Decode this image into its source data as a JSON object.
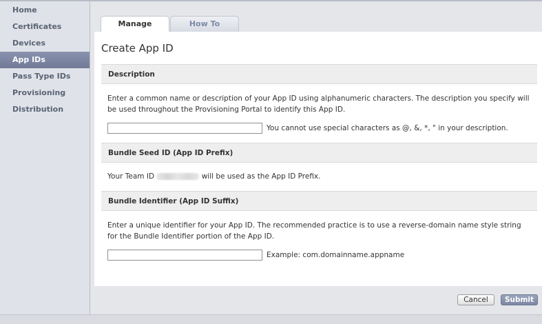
{
  "sidebar": {
    "items": [
      {
        "label": "Home",
        "active": false
      },
      {
        "label": "Certificates",
        "active": false
      },
      {
        "label": "Devices",
        "active": false
      },
      {
        "label": "App IDs",
        "active": true
      },
      {
        "label": "Pass Type IDs",
        "active": false
      },
      {
        "label": "Provisioning",
        "active": false
      },
      {
        "label": "Distribution",
        "active": false
      }
    ]
  },
  "tabs": {
    "manage": "Manage",
    "howto": "How To"
  },
  "page": {
    "title": "Create App ID"
  },
  "description": {
    "header": "Description",
    "text": "Enter a common name or description of your App ID using alphanumeric characters. The description you specify will be used throughout the Provisioning Portal to identify this App ID.",
    "input_value": "",
    "hint": "You cannot use special characters as @, &, *, \" in your description."
  },
  "bundle_seed": {
    "header": "Bundle Seed ID (App ID Prefix)",
    "text_before": "Your Team ID",
    "text_after": "will be used as the App ID Prefix."
  },
  "bundle_identifier": {
    "header": "Bundle Identifier (App ID Suffix)",
    "text": "Enter a unique identifier for your App ID. The recommended practice is to use a reverse-domain name style string for the Bundle Identifier portion of the App ID.",
    "input_value": "",
    "hint": "Example: com.domainname.appname"
  },
  "footer": {
    "cancel_label": "Cancel",
    "submit_label": "Submit"
  },
  "colors": {
    "active_nav": "#7c86a2",
    "submit_button": "#8690ab",
    "tab_inactive_text": "#7a8aa6"
  }
}
